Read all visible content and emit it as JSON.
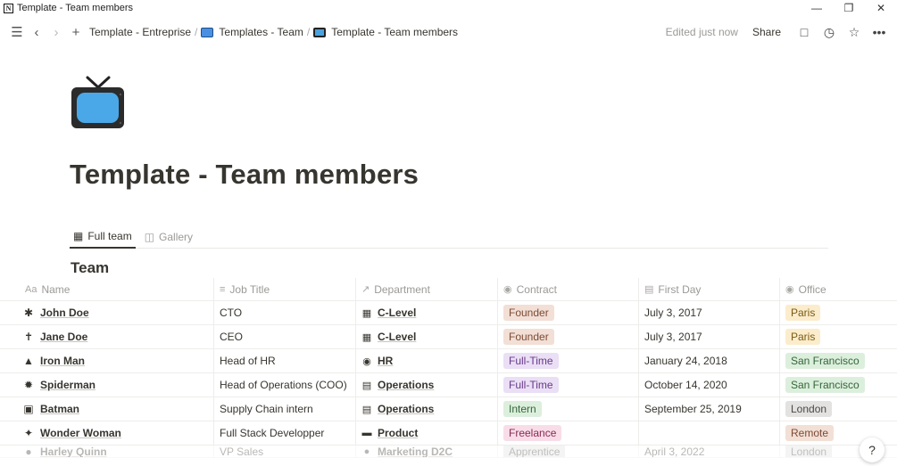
{
  "window": {
    "title": "Template - Team members",
    "app_icon": "N"
  },
  "breadcrumb": {
    "items": [
      {
        "label": "Template - Entreprise",
        "icon": ""
      },
      {
        "label": "Templates - Team",
        "icon": "monitor-emoji"
      },
      {
        "label": "Template - Team members",
        "icon": "tv-emoji"
      }
    ],
    "separator": "/"
  },
  "toolbar": {
    "edited": "Edited just now",
    "share": "Share"
  },
  "page": {
    "title": "Template - Team members",
    "icon": "tv-emoji"
  },
  "tabs": [
    {
      "label": "Full team",
      "icon": "table-icon",
      "active": true
    },
    {
      "label": "Gallery",
      "icon": "gallery-icon",
      "active": false
    }
  ],
  "database": {
    "title": "Team",
    "columns": [
      {
        "label": "Name",
        "prefix": "Aa"
      },
      {
        "label": "Job Title",
        "icon": "text-lines-icon"
      },
      {
        "label": "Department",
        "icon": "arrow-ne-icon"
      },
      {
        "label": "Contract",
        "icon": "select-icon"
      },
      {
        "label": "First Day",
        "icon": "calendar-icon"
      },
      {
        "label": "Office",
        "icon": "select-icon"
      }
    ],
    "rows": [
      {
        "name": "John Doe",
        "job": "CTO",
        "department": "C-Level",
        "contract": "Founder",
        "first_day": "July 3, 2017",
        "office": "Paris"
      },
      {
        "name": "Jane Doe",
        "job": "CEO",
        "department": "C-Level",
        "contract": "Founder",
        "first_day": "July 3, 2017",
        "office": "Paris"
      },
      {
        "name": "Iron Man",
        "job": "Head of HR",
        "department": "HR",
        "contract": "Full-Time",
        "first_day": "January 24, 2018",
        "office": "San Francisco"
      },
      {
        "name": "Spiderman",
        "job": "Head of Operations (COO)",
        "department": "Operations",
        "contract": "Full-Time",
        "first_day": "October 14, 2020",
        "office": "San Francisco"
      },
      {
        "name": "Batman",
        "job": "Supply Chain intern",
        "department": "Operations",
        "contract": "Intern",
        "first_day": "September 25, 2019",
        "office": "London"
      },
      {
        "name": "Wonder Woman",
        "job": "Full Stack Developper",
        "department": "Product",
        "contract": "Freelance",
        "first_day": "",
        "office": "Remote"
      },
      {
        "name": "Harley Quinn",
        "job": "VP Sales",
        "department": "Marketing D2C",
        "contract": "Apprentice",
        "first_day": "April 3, 2022",
        "office": "London"
      }
    ]
  },
  "help": {
    "label": "?"
  }
}
